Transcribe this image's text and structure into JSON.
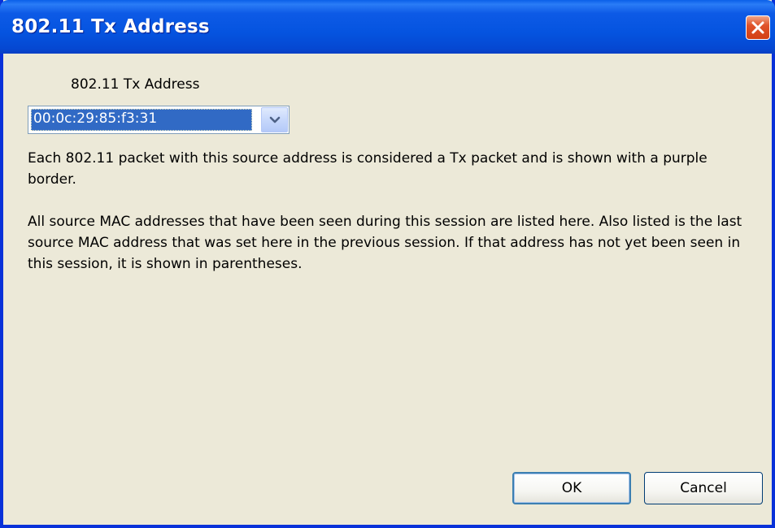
{
  "window": {
    "title": "802.11 Tx Address"
  },
  "form": {
    "field_label": "802.11 Tx Address",
    "selected_address": "00:0c:29:85:f3:31"
  },
  "description": {
    "paragraph1": "Each 802.11 packet with this source address is considered a Tx packet and is shown with a purple border.",
    "paragraph2": "All source MAC addresses that have been seen during this session are listed here.  Also listed is the last source MAC address that was set here in the previous session.  If that address has not yet been seen in this session, it is shown in parentheses."
  },
  "buttons": {
    "ok_label": "OK",
    "cancel_label": "Cancel"
  },
  "icons": {
    "close": "close-icon",
    "dropdown": "chevron-down-icon"
  },
  "colors": {
    "titlebar": "#0554e0",
    "selection": "#316ac5",
    "dialog_bg": "#ece9d8",
    "close_button": "#e0532a"
  }
}
